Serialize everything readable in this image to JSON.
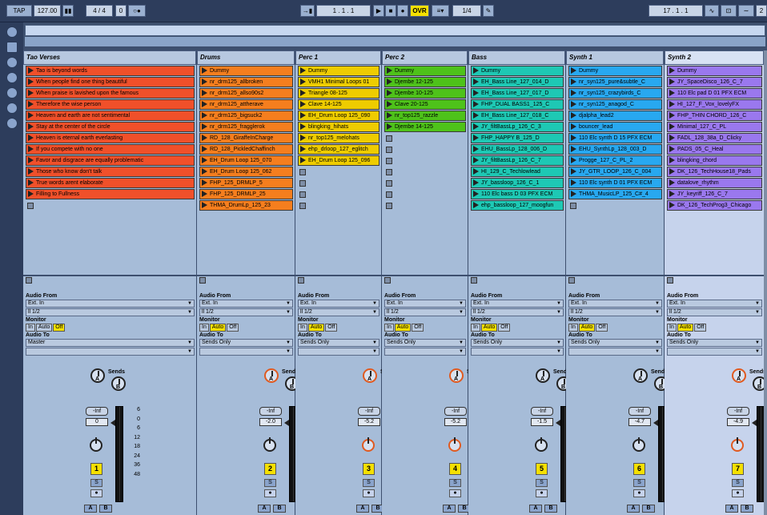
{
  "topbar": {
    "tap": "TAP",
    "tempo": "127.00",
    "pause_icon": "▮▮",
    "sig": "4 / 4",
    "zero": "0",
    "rec_icon": "○●",
    "arrange_icon": "→▮",
    "position": "1 .  1 .  1",
    "play_icon": "▶",
    "stop_icon": "■",
    "rec2_icon": "●",
    "ovr": "OVR",
    "menu_icon": "≡▾",
    "quant": "1/4",
    "pencil_icon": "✎",
    "loop_pos": "17 .  1 .  1",
    "wave_icon": "∿",
    "punch_icon": "⊡",
    "wave2_icon": "∼",
    "end": "2"
  },
  "tracks": [
    {
      "name": "Tao Verses",
      "clips": [
        {
          "t": "Tao is beyond words",
          "c": "#f0502a"
        },
        {
          "t": "When people find one thing beautiful",
          "c": "#f0502a"
        },
        {
          "t": "When praise is lavished upon the famous",
          "c": "#f0502a"
        },
        {
          "t": "Therefore the wise person",
          "c": "#f0502a"
        },
        {
          "t": "Heaven and earth are not sentimental",
          "c": "#f0502a"
        },
        {
          "t": "Stay at the center of the circle",
          "c": "#f0502a"
        },
        {
          "t": "Heaven is eternal earth everlasting",
          "c": "#f0502a"
        },
        {
          "t": "If you compete with no one",
          "c": "#f0502a"
        },
        {
          "t": "Favor and disgrace are equally problematic",
          "c": "#f0502a"
        },
        {
          "t": "Those who know don't talk",
          "c": "#f0502a"
        },
        {
          "t": "True words arent elaborate",
          "c": "#f0502a"
        },
        {
          "t": "Filling to Fullness",
          "c": "#f0502a"
        }
      ],
      "stops": 1,
      "audio_from": "Ext. In",
      "chan": "ll 1/2",
      "monitor": "Off",
      "audio_to": "Master",
      "vol": "0",
      "num": "1",
      "pan_orange": false,
      "knobA_orange": false
    },
    {
      "name": "Drums",
      "clips": [
        {
          "t": "Dummy",
          "c": "#f57e1e"
        },
        {
          "t": "nr_drm125_allbroken",
          "c": "#f57e1e"
        },
        {
          "t": "nr_drm125_allso90s2",
          "c": "#f57e1e"
        },
        {
          "t": "nr_drm125_attherave",
          "c": "#f57e1e"
        },
        {
          "t": "nr_drm125_bigsuck2",
          "c": "#f57e1e"
        },
        {
          "t": "nr_drm125_fragglerok",
          "c": "#f57e1e"
        },
        {
          "t": "RD_128_GiraffeInCharge",
          "c": "#f57e1e"
        },
        {
          "t": "RD_128_PickledChaffinch",
          "c": "#f57e1e"
        },
        {
          "t": "EH_Drum Loop 125_070",
          "c": "#f57e1e"
        },
        {
          "t": "EH_Drum Loop 125_062",
          "c": "#f57e1e"
        },
        {
          "t": "FHP_125_DRMLP_5",
          "c": "#f57e1e"
        },
        {
          "t": "FHP_125_DRMLP_25",
          "c": "#f57e1e"
        },
        {
          "t": "THMA_DrumLp_125_23",
          "c": "#f57e1e"
        }
      ],
      "stops": 0,
      "audio_from": "Ext. In",
      "chan": "ll 1/2",
      "monitor": "Auto",
      "audio_to": "Sends Only",
      "vol": "-2.0",
      "num": "2",
      "pan_orange": false,
      "knobA_orange": true
    },
    {
      "name": "Perc 1",
      "clips": [
        {
          "t": "Dummy",
          "c": "#eecc00"
        },
        {
          "t": "VMH1 Minimal Loops 01",
          "c": "#eecc00"
        },
        {
          "t": "Triangle 08-125",
          "c": "#eecc00"
        },
        {
          "t": "Clave 14-125",
          "c": "#eecc00"
        },
        {
          "t": "EH_Drum Loop 125_090",
          "c": "#eecc00"
        },
        {
          "t": "blingking_hihats",
          "c": "#eecc00"
        },
        {
          "t": "nr_top125_melohats",
          "c": "#eecc00"
        },
        {
          "t": "ehp_drloop_127_eglitch",
          "c": "#eecc00"
        },
        {
          "t": "EH_Drum Loop 125_096",
          "c": "#eecc00"
        }
      ],
      "stops": 4,
      "audio_from": "Ext. In",
      "chan": "ll 1/2",
      "monitor": "Auto",
      "audio_to": "Sends Only",
      "vol": "-5.2",
      "num": "3",
      "pan_orange": true,
      "knobA_orange": true
    },
    {
      "name": "Perc 2",
      "clips": [
        {
          "t": "Dummy",
          "c": "#4ec21a"
        },
        {
          "t": "Djembe 12-125",
          "c": "#4ec21a"
        },
        {
          "t": "Djembe 10-125",
          "c": "#4ec21a"
        },
        {
          "t": "Clave 20-125",
          "c": "#4ec21a"
        },
        {
          "t": "nr_top125_razzle",
          "c": "#4ec21a"
        },
        {
          "t": "Djembe 14-125",
          "c": "#4ec21a"
        }
      ],
      "stops": 7,
      "audio_from": "Ext. In",
      "chan": "ll 1/2",
      "monitor": "Auto",
      "audio_to": "Sends Only",
      "vol": "-5.2",
      "num": "4",
      "pan_orange": true,
      "knobA_orange": true
    },
    {
      "name": "Bass",
      "clips": [
        {
          "t": "Dummy",
          "c": "#1ec8b4"
        },
        {
          "t": "EH_Bass Line_127_014_D",
          "c": "#1ec8b4"
        },
        {
          "t": "EH_Bass Line_127_017_D",
          "c": "#1ec8b4"
        },
        {
          "t": "FHP_DUAL BASS1_125_C",
          "c": "#1ec8b4"
        },
        {
          "t": "EH_Bass Line_127_018_C",
          "c": "#1ec8b4"
        },
        {
          "t": "JY_filtBassLp_126_C_3",
          "c": "#1ec8b4"
        },
        {
          "t": "FHP_HAPPY B_125_D",
          "c": "#1ec8b4"
        },
        {
          "t": "EHU_BassLp_128_006_D",
          "c": "#1ec8b4"
        },
        {
          "t": "JY_filtBassLp_126_C_7",
          "c": "#1ec8b4"
        },
        {
          "t": "HI_129_C_Techlowlead",
          "c": "#1ec8b4"
        },
        {
          "t": "JY_bassloop_126_C_1",
          "c": "#1ec8b4"
        },
        {
          "t": "110 Elc bass D 03 PFX ECM",
          "c": "#1ec8b4"
        },
        {
          "t": "ehp_bassloop_127_moogfun",
          "c": "#1ec8b4"
        }
      ],
      "stops": 0,
      "audio_from": "Ext. In",
      "chan": "ll 1/2",
      "monitor": "Auto",
      "audio_to": "Sends Only",
      "vol": "-1.5",
      "num": "5",
      "pan_orange": false,
      "knobA_orange": false
    },
    {
      "name": "Synth 1",
      "clips": [
        {
          "t": "Dummy",
          "c": "#28a8f0"
        },
        {
          "t": "nr_syn125_pure&subtle_C",
          "c": "#28a8f0"
        },
        {
          "t": "nr_syn125_crazybirds_C",
          "c": "#28a8f0"
        },
        {
          "t": "nr_syn125_anagod_C",
          "c": "#28a8f0"
        },
        {
          "t": "djalpha_lead2",
          "c": "#28a8f0"
        },
        {
          "t": "bouncer_lead",
          "c": "#28a8f0"
        },
        {
          "t": "110 Elc synth D 15 PFX ECM",
          "c": "#28a8f0"
        },
        {
          "t": "EHU_SynthLp_128_003_D",
          "c": "#28a8f0"
        },
        {
          "t": "Progge_127_C_PL_2",
          "c": "#28a8f0"
        },
        {
          "t": "JY_GTR_LOOP_126_C_004",
          "c": "#28a8f0"
        },
        {
          "t": "110 Elc synth D 01 PFX ECM",
          "c": "#28a8f0"
        },
        {
          "t": "THMA_MusicLP_125_C#_4",
          "c": "#28a8f0"
        }
      ],
      "stops": 1,
      "audio_from": "Ext. In",
      "chan": "ll 1/2",
      "monitor": "Auto",
      "audio_to": "Sends Only",
      "vol": "-4.7",
      "num": "6",
      "pan_orange": false,
      "knobA_orange": false
    },
    {
      "name": "Synth 2",
      "clips": [
        {
          "t": "Dummy",
          "c": "#9a78ee"
        },
        {
          "t": "JY_SpaceDisco_126_C_7",
          "c": "#9a78ee"
        },
        {
          "t": "110 Elc pad D 01 PFX ECM",
          "c": "#9a78ee"
        },
        {
          "t": "HI_127_F_Vox_lovelyFX",
          "c": "#9a78ee"
        },
        {
          "t": "FHP_THIN CHORD_126_C",
          "c": "#9a78ee"
        },
        {
          "t": "Minimal_127_C_PL",
          "c": "#9a78ee"
        },
        {
          "t": "FADL_128_38a_D_Clicky",
          "c": "#9a78ee"
        },
        {
          "t": "PADS_05_C_Heal",
          "c": "#9a78ee"
        },
        {
          "t": "blingking_chord",
          "c": "#9a78ee"
        },
        {
          "t": "DK_126_TechHouse18_Pads",
          "c": "#9a78ee"
        },
        {
          "t": "datalove_rhythm",
          "c": "#9a78ee"
        },
        {
          "t": "JY_keyriff_126_C_7",
          "c": "#9a78ee"
        },
        {
          "t": "DK_126_TechProg3_Chicago",
          "c": "#9a78ee"
        }
      ],
      "stops": 0,
      "audio_from": "Ext. In",
      "chan": "ll 1/2",
      "monitor": "Auto",
      "audio_to": "Sends Only",
      "vol": "-4.9",
      "num": "7",
      "pan_orange": true,
      "knobA_orange": true
    }
  ],
  "labels": {
    "audio_from": "Audio From",
    "monitor": "Monitor",
    "audio_to": "Audio To",
    "in": "In",
    "auto": "Auto",
    "off": "Off",
    "sends": "Sends",
    "inf": "-Inf",
    "s": "S",
    "a": "A",
    "b": "B",
    "scale": [
      "6",
      "0",
      "6",
      "12",
      "18",
      "24",
      "36",
      "48"
    ],
    "knob_a": "A",
    "knob_b": "B"
  }
}
